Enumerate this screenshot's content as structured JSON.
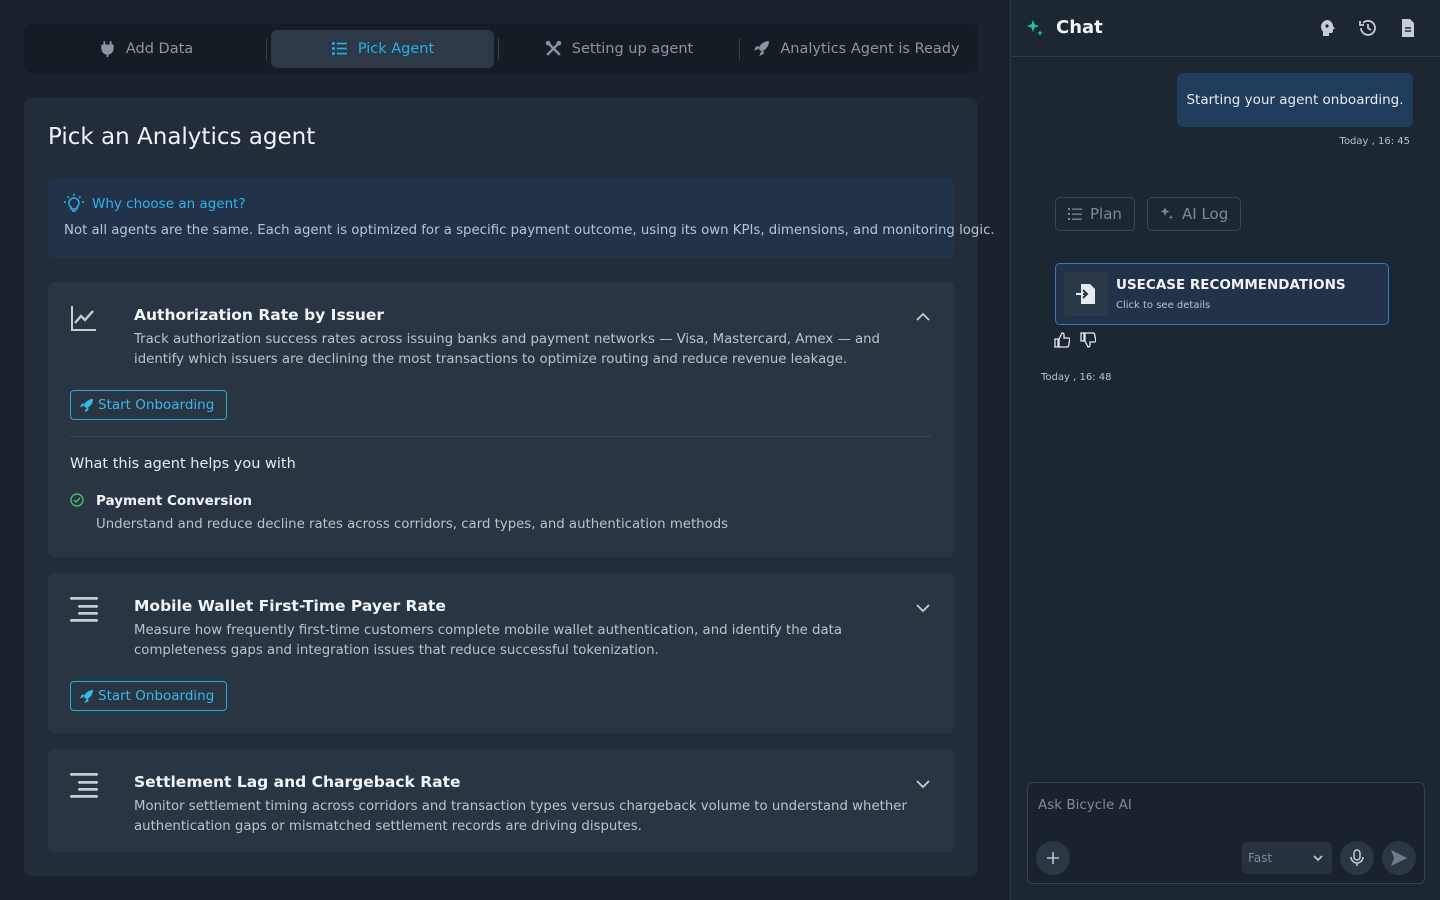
{
  "stepper": {
    "steps": [
      {
        "label": "Add Data",
        "icon": "plug-icon"
      },
      {
        "label": "Pick Agent",
        "icon": "list-icon"
      },
      {
        "label": "Setting up agent",
        "icon": "tools-icon"
      },
      {
        "label": "Analytics Agent is Ready",
        "icon": "rocket-icon"
      }
    ],
    "active_index": 1
  },
  "page": {
    "title": "Pick an Analytics agent"
  },
  "info": {
    "heading": "Why choose an agent?",
    "text": "Not all agents are the same. Each agent is optimized for a specific payment outcome, using its own KPIs, dimensions, and monitoring logic."
  },
  "agents": [
    {
      "title": "Authorization Rate by Issuer",
      "description": "Track authorization success rates across issuing banks and payment networks — Visa, Mastercard, Amex — and identify which issuers are declining the most transactions to optimize routing and reduce revenue leakage.",
      "button": "Start Onboarding",
      "expanded": true,
      "helps_title": "What this agent helps you with",
      "benefit_title": "Payment Conversion",
      "benefit_desc": "Understand and reduce decline rates across corridors, card types, and authentication methods"
    },
    {
      "title": "Mobile Wallet First-Time Payer Rate",
      "description": "Measure how frequently first-time customers complete mobile wallet authentication, and identify the data completeness gaps and integration issues that reduce successful tokenization.",
      "button": "Start Onboarding",
      "expanded": false
    },
    {
      "title": "Settlement Lag and Chargeback Rate",
      "description": "Monitor settlement timing across corridors and transaction types versus chargeback volume to understand whether authentication gaps or mismatched settlement records are driving disputes.",
      "expanded": false
    }
  ],
  "chat": {
    "title": "Chat",
    "user_message": "Starting your agent onboarding.",
    "user_timestamp": "Today , 16: 45",
    "tabs": [
      "Plan",
      "AI Log"
    ],
    "usecase_title": "USECASE RECOMMENDATIONS",
    "usecase_sub": "Click to see details",
    "ai_timestamp": "Today , 16: 48",
    "input_placeholder": "Ask Bicycle AI",
    "mode": "Fast"
  },
  "colors": {
    "accent": "#26b0e8",
    "success": "#3fbf6a",
    "panel": "#222d39",
    "card": "#2a3542"
  }
}
